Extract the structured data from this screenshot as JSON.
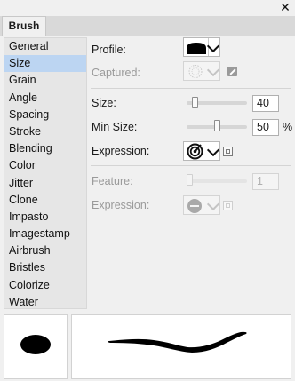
{
  "window": {
    "close_glyph": "✕"
  },
  "tab": {
    "label": "Brush"
  },
  "categories": [
    {
      "label": "General",
      "selected": false
    },
    {
      "label": "Size",
      "selected": true
    },
    {
      "label": "Grain",
      "selected": false
    },
    {
      "label": "Angle",
      "selected": false
    },
    {
      "label": "Spacing",
      "selected": false
    },
    {
      "label": "Stroke",
      "selected": false
    },
    {
      "label": "Blending",
      "selected": false
    },
    {
      "label": "Color",
      "selected": false
    },
    {
      "label": "Jitter",
      "selected": false
    },
    {
      "label": "Clone",
      "selected": false
    },
    {
      "label": "Impasto",
      "selected": false
    },
    {
      "label": "Imagestamp",
      "selected": false
    },
    {
      "label": "Airbrush",
      "selected": false
    },
    {
      "label": "Bristles",
      "selected": false
    },
    {
      "label": "Colorize",
      "selected": false
    },
    {
      "label": "Water",
      "selected": false
    }
  ],
  "settings": {
    "profile": {
      "label": "Profile:",
      "icon": "brush-profile-icon"
    },
    "captured": {
      "label": "Captured:",
      "icon": "captured-dab-icon",
      "action_icon": "capture-wand-icon",
      "enabled": false
    },
    "size": {
      "label": "Size:",
      "value": "40",
      "slider_fraction": 0.1
    },
    "min_size": {
      "label": "Min Size:",
      "value": "50",
      "unit": "%",
      "slider_fraction": 0.5
    },
    "expression": {
      "label": "Expression:",
      "icon": "pressure-target-icon",
      "action_icon": "expression-settings-icon"
    },
    "feature": {
      "label": "Feature:",
      "value": "1",
      "slider_fraction": 0.0,
      "enabled": false
    },
    "expression2": {
      "label": "Expression:",
      "icon": "none-circle-icon",
      "action_icon": "expression-settings-icon",
      "enabled": false
    }
  },
  "preview": {
    "dab_icon": "dab-preview",
    "stroke_icon": "stroke-preview"
  },
  "colors": {
    "selection": "#bcd5f2",
    "panel": "#f0f0f0"
  }
}
